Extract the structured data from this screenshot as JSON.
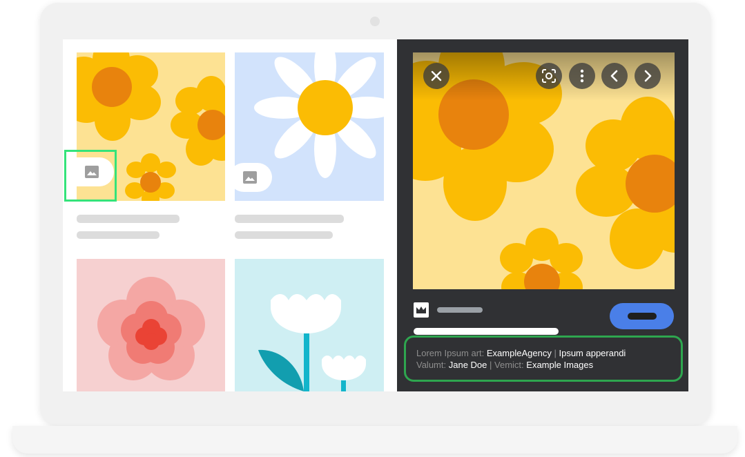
{
  "colors": {
    "panel_dark": "#303134",
    "accent_green": "#34e37a",
    "credit_border": "#2ea64f",
    "button_blue": "#4a7fe8"
  },
  "viewer": {
    "icons": [
      "close-icon",
      "lens-icon",
      "more-vert-icon",
      "chevron-left-icon",
      "chevron-right-icon"
    ],
    "credits": {
      "line1": {
        "label1": "Lorem Ipsum art:",
        "value1": "ExampleAgency",
        "sep": "|",
        "value2": "Ipsum apperandi"
      },
      "line2": {
        "label1": "Valumt:",
        "value1": "Jane Doe",
        "sep": "|",
        "label2": "Vemict:",
        "value2": "Example Images"
      }
    }
  },
  "grid": {
    "icons": [
      "image-icon",
      "image-icon"
    ]
  }
}
